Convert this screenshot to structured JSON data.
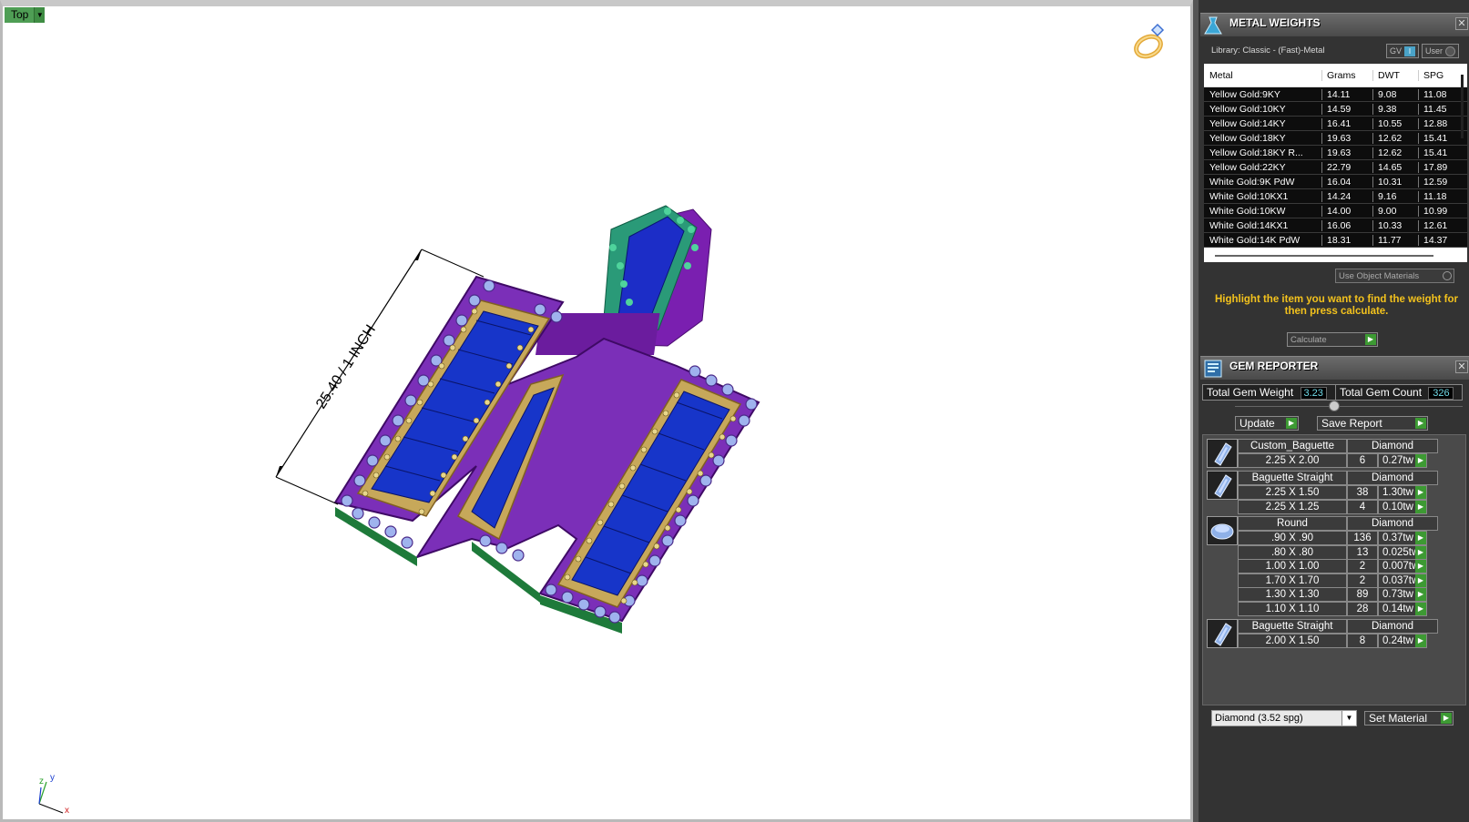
{
  "viewport": {
    "view_name": "Top",
    "dimension_text": "25.40 / 1 INCH",
    "axis_labels": {
      "x": "x",
      "y": "y",
      "z": "z"
    }
  },
  "metal_weights": {
    "title": "METAL WEIGHTS",
    "library": "Library: Classic - (Fast)-Metal",
    "toggle_gv": "GV",
    "toggle_gv_value": "I",
    "toggle_user": "User",
    "columns": [
      "Metal",
      "Grams",
      "DWT",
      "SPG"
    ],
    "rows": [
      [
        "Yellow Gold:9KY",
        "14.11",
        "9.08",
        "11.08"
      ],
      [
        "Yellow Gold:10KY",
        "14.59",
        "9.38",
        "11.45"
      ],
      [
        "Yellow Gold:14KY",
        "16.41",
        "10.55",
        "12.88"
      ],
      [
        "Yellow Gold:18KY",
        "19.63",
        "12.62",
        "15.41"
      ],
      [
        "Yellow Gold:18KY R...",
        "19.63",
        "12.62",
        "15.41"
      ],
      [
        "Yellow Gold:22KY",
        "22.79",
        "14.65",
        "17.89"
      ],
      [
        "White Gold:9K PdW",
        "16.04",
        "10.31",
        "12.59"
      ],
      [
        "White Gold:10KX1",
        "14.24",
        "9.16",
        "11.18"
      ],
      [
        "White Gold:10KW",
        "14.00",
        "9.00",
        "10.99"
      ],
      [
        "White Gold:14KX1",
        "16.06",
        "10.33",
        "12.61"
      ],
      [
        "White Gold:14K PdW",
        "18.31",
        "11.77",
        "14.37"
      ]
    ],
    "use_object_materials": "Use Object Materials",
    "hint": "Highlight the item you want to find the weight for then press calculate.",
    "calculate_label": "Calculate"
  },
  "gem_reporter": {
    "title": "GEM REPORTER",
    "total_gem_weight_label": "Total Gem Weight",
    "total_gem_weight": "3.23",
    "total_gem_count_label": "Total Gem Count",
    "total_gem_count": "326",
    "update_label": "Update",
    "save_report_label": "Save Report",
    "groups": [
      {
        "shape": "Custom_Baguette",
        "material": "Diamond",
        "thumb": "baguette-gem-icon",
        "rows": [
          [
            "2.25 X 2.00",
            "6",
            "0.27tw"
          ]
        ]
      },
      {
        "shape": "Baguette Straight",
        "material": "Diamond",
        "thumb": "baguette-gem-icon",
        "rows": [
          [
            "2.25 X 1.50",
            "38",
            "1.30tw"
          ],
          [
            "2.25 X 1.25",
            "4",
            "0.10tw"
          ]
        ]
      },
      {
        "shape": "Round",
        "material": "Diamond",
        "thumb": "round-gem-icon",
        "rows": [
          [
            ".90 X .90",
            "136",
            "0.37tw"
          ],
          [
            ".80 X .80",
            "13",
            "0.025tw"
          ],
          [
            "1.00 X 1.00",
            "2",
            "0.007tw"
          ],
          [
            "1.70 X 1.70",
            "2",
            "0.037tw"
          ],
          [
            "1.30 X 1.30",
            "89",
            "0.73tw"
          ],
          [
            "1.10 X 1.10",
            "28",
            "0.14tw"
          ]
        ]
      },
      {
        "shape": "Baguette Straight",
        "material": "Diamond",
        "thumb": "baguette-gem-icon",
        "rows": [
          [
            "2.00 X 1.50",
            "8",
            "0.24tw"
          ]
        ]
      }
    ],
    "material_select": "Diamond    (3.52 spg)",
    "set_material_label": "Set Material"
  },
  "colors": {
    "viewport_bg": "#ffffff",
    "panel_bg": "#333333",
    "hint_text": "#f3c21d",
    "accent_green": "#3d9a33",
    "view_label_bg": "#4f9e55"
  }
}
